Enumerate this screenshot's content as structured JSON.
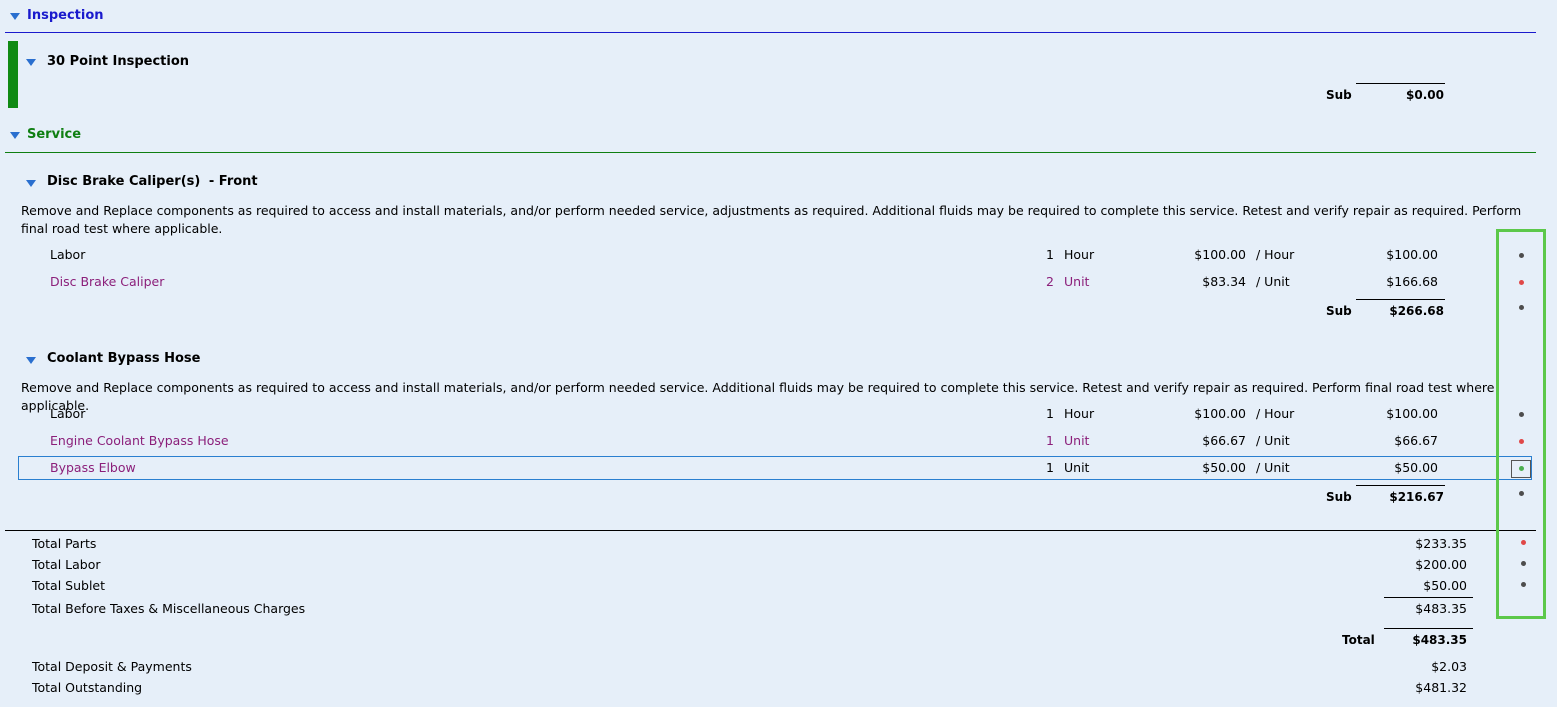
{
  "inspection": {
    "header": "Inspection",
    "group_title": "30 Point Inspection",
    "sub_label": "Sub",
    "sub_value": "$0.00"
  },
  "service": {
    "header": "Service",
    "jobs": [
      {
        "title": "Disc Brake Caliper(s)",
        "title_suffix": "- Front",
        "description": "Remove and Replace components as required to access and install materials, and/or perform needed service, adjustments as required.  Additional fluids may be required to complete this service.  Retest and verify repair as required.  Perform final road test where applicable.",
        "lines": [
          {
            "name": "Labor",
            "qty": "1",
            "unit": "Hour",
            "rate": "$100.00",
            "rate_unit": "/ Hour",
            "total": "$100.00"
          },
          {
            "name": "Disc Brake Caliper",
            "qty": "2",
            "unit": "Unit",
            "rate": "$83.34",
            "rate_unit": "/ Unit",
            "total": "$166.68"
          }
        ],
        "sub_label": "Sub",
        "sub_value": "$266.68"
      },
      {
        "title": "Coolant Bypass Hose",
        "description": "Remove and Replace components as required to access and install materials, and/or perform needed service.  Additional fluids may be required to complete this service.  Retest and verify repair as required.  Perform final road test where applicable.",
        "lines": [
          {
            "name": "Labor",
            "qty": "1",
            "unit": "Hour",
            "rate": "$100.00",
            "rate_unit": "/ Hour",
            "total": "$100.00"
          },
          {
            "name": "Engine Coolant Bypass Hose",
            "qty": "1",
            "unit": "Unit",
            "rate": "$66.67",
            "rate_unit": "/ Unit",
            "total": "$66.67"
          },
          {
            "name": "Bypass Elbow",
            "qty": "1",
            "unit": "Unit",
            "rate": "$50.00",
            "rate_unit": "/ Unit",
            "total": "$50.00"
          }
        ],
        "sub_label": "Sub",
        "sub_value": "$216.67"
      }
    ]
  },
  "totals": {
    "parts_label": "Total Parts",
    "parts": "$233.35",
    "labor_label": "Total Labor",
    "labor": "$200.00",
    "sublet_label": "Total Sublet",
    "sublet": "$50.00",
    "before_taxes_label": "Total Before Taxes & Miscellaneous Charges",
    "before_taxes": "$483.35",
    "total_label": "Total",
    "total": "$483.35",
    "deposit_label": "Total Deposit & Payments",
    "deposit": "$2.03",
    "outstanding_label": "Total Outstanding",
    "outstanding": "$481.32"
  },
  "colors": {
    "inspection_header": "#1a1acd",
    "service_header": "#0f7f12",
    "part_text": "#8b1f7a",
    "highlight_box": "#5cc84a",
    "selection_border": "#2a7fd0"
  },
  "status_dots": [
    "gray",
    "red",
    "gray",
    "gray",
    "red",
    "green",
    "gray",
    "red",
    "gray",
    "gray"
  ]
}
